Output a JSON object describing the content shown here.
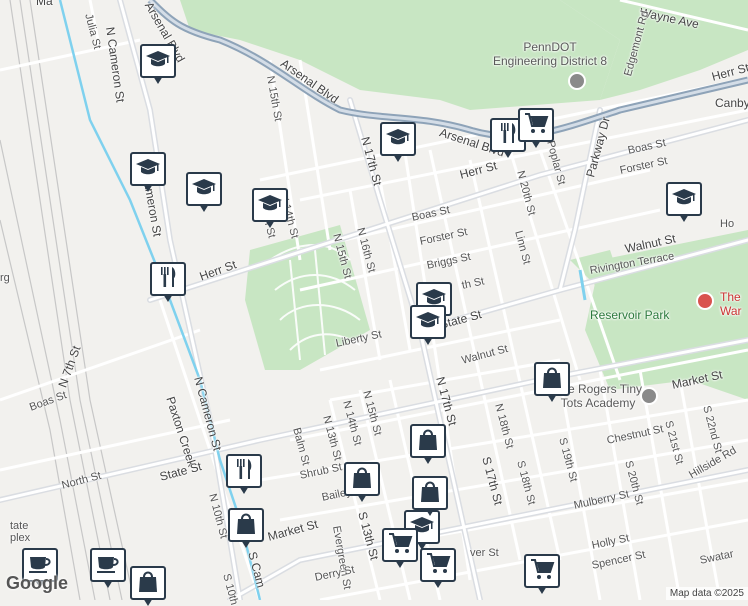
{
  "map": {
    "attribution": "Map data ©2025",
    "logo": "Google",
    "colors": {
      "land": "#f2f1ee",
      "park": "#c8e6c3",
      "road": "#ffffff",
      "arterial": "#d6d9de",
      "water": "#7fd1ee",
      "blvd": "#8ea3b8"
    }
  },
  "streets": {
    "arsenal_blvd": "Arsenal Blvd",
    "n_15th_top": "N 15th St",
    "n_17th_top": "N 17th St",
    "herr_st_right": "Herr St",
    "herr_st_left": "Herr St",
    "herr_st_top_right": "Herr St",
    "canby": "Canby",
    "wayne_ave": "Wayne Ave",
    "boas_st": "Boas St",
    "boas_st_right": "Boas St",
    "boas_st_left": "Boas St",
    "forster_st": "Forster St",
    "forster_st_right": "Forster St",
    "briggs_st": "Briggs St",
    "walnut_st": "Walnut St",
    "walnut_st_lower": "Walnut St",
    "rivington": "Rivington Terrace",
    "n_14th": "N 14th St",
    "n_13th_partial": "th St",
    "n_15th": "N 15th St",
    "n_16th": "N 16th St",
    "n_18th_partial": "th St",
    "state_st": "State St",
    "state_st_left": "State St",
    "liberty_st": "Liberty St",
    "n_cameron_top": "N Cameron St",
    "n_cameron": "N Cameron St",
    "cameron_partial": "ameron St",
    "n_7th": "N 7th St",
    "north_st": "North St",
    "n_10th": "N 10th St",
    "n_13th": "N 13th St",
    "n_14th_lower": "N 14th St",
    "n_15th_lower": "N 15th St",
    "n_17th_lower": "N 17th St",
    "n_18th_lower": "N 18th St",
    "n_20th": "N 20th St",
    "linn_st": "Linn St",
    "poplar_st": "Poplar St",
    "parkway_dr": "Parkway Dr",
    "edgemont_rd": "Edgemont Rd",
    "balm_st": "Balm St",
    "shrub_st": "Shrub St",
    "bailey": "Bailey",
    "market_st": "Market St",
    "market_st_right": "Market St",
    "evergreen_st": "Evergreen St",
    "s_13th": "S 13th St",
    "s_17th": "S 17th St",
    "s_18th": "S 18th St",
    "s_18th_b": "S 18th St",
    "s_19th": "S 19th St",
    "s_20th": "S 20th St",
    "s_21st": "S 21st St",
    "s_22nd": "S 22nd St",
    "chestnut_st": "Chestnut St",
    "mulberry_st": "Mulberry St",
    "holly_st": "Holly St",
    "spencer_st": "Spencer St",
    "derry_st": "Derry St",
    "hillside_rd": "Hillside Rd",
    "s_cameron": "S Cam",
    "s_10th": "S 10th",
    "paxton_creek": "Paxton Creek",
    "julia_st": "Julia St",
    "ma_partial": "Ma",
    "ver_st": "ver St",
    "swatara": "Swatar",
    "hc_partial": "Ho",
    "rg_partial": "rg",
    "state_complex": "tate\nplex"
  },
  "pois": {
    "penndot": "PennDOT\nEngineering District 8",
    "reservoir_park": "Reservoir Park",
    "museum": "The\nWar",
    "tiny_tots": "The Rogers Tiny\nTots Academy"
  },
  "pins": [
    {
      "icon": "school-icon"
    },
    {
      "icon": "school-icon"
    },
    {
      "icon": "school-icon"
    },
    {
      "icon": "school-icon"
    },
    {
      "icon": "school-icon"
    },
    {
      "icon": "school-icon"
    },
    {
      "icon": "school-icon"
    },
    {
      "icon": "school-icon"
    },
    {
      "icon": "school-icon"
    },
    {
      "icon": "restaurant-icon"
    },
    {
      "icon": "restaurant-icon"
    },
    {
      "icon": "restaurant-icon"
    },
    {
      "icon": "grocery-icon"
    },
    {
      "icon": "grocery-icon"
    },
    {
      "icon": "grocery-icon"
    },
    {
      "icon": "grocery-icon"
    },
    {
      "icon": "shopping-icon"
    },
    {
      "icon": "shopping-icon"
    },
    {
      "icon": "shopping-icon"
    },
    {
      "icon": "shopping-icon"
    },
    {
      "icon": "shopping-icon"
    },
    {
      "icon": "shopping-icon"
    },
    {
      "icon": "cafe-icon"
    },
    {
      "icon": "cafe-icon"
    }
  ]
}
